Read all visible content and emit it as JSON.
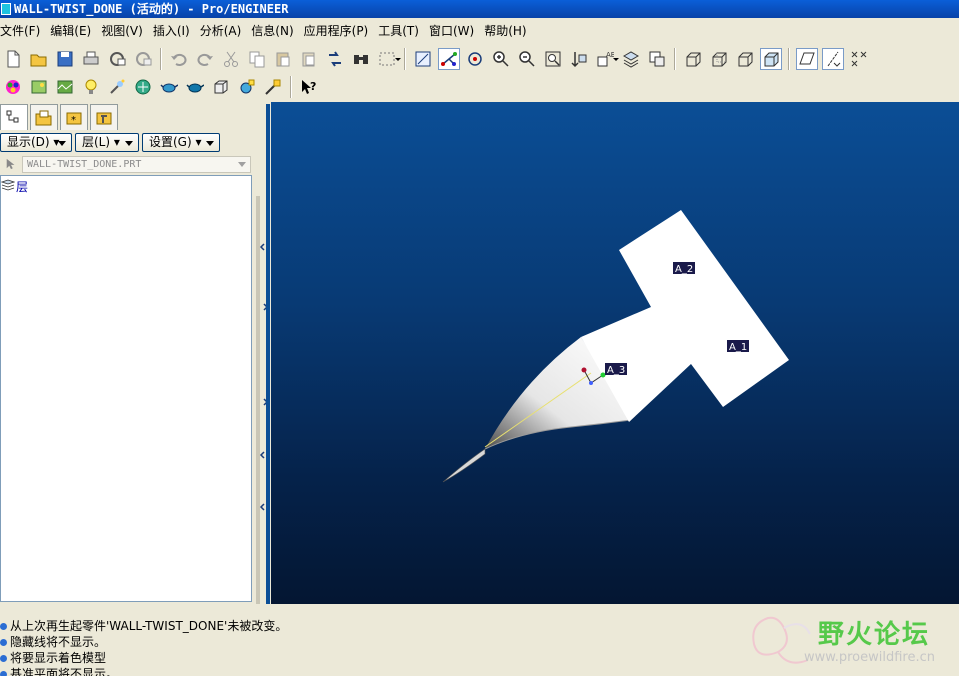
{
  "window": {
    "title": "WALL-TWIST_DONE (活动的) - Pro/ENGINEER"
  },
  "menu": [
    {
      "label": "文件(F)"
    },
    {
      "label": "编辑(E)"
    },
    {
      "label": "视图(V)"
    },
    {
      "label": "插入(I)"
    },
    {
      "label": "分析(A)"
    },
    {
      "label": "信息(N)"
    },
    {
      "label": "应用程序(P)"
    },
    {
      "label": "工具(T)"
    },
    {
      "label": "窗口(W)"
    },
    {
      "label": "帮助(H)"
    }
  ],
  "left_panel": {
    "show_button": "显示(D) ▾",
    "layer_button": "层(L) ▾",
    "settings_button": "设置(G) ▾",
    "model_name": "WALL-TWIST_DONE.PRT",
    "tree_root": "层"
  },
  "graphics": {
    "csys_label": "A_3",
    "datum_labels": [
      {
        "text": "A_2"
      },
      {
        "text": "A_1"
      }
    ],
    "background_top": "#0b4e96",
    "background_bottom": "#041632"
  },
  "messages": [
    "从上次再生起零件'WALL-TWIST_DONE'未被改变。",
    "隐藏线将不显示。",
    "将要显示着色模型",
    "基准平面将不显示。"
  ],
  "watermark": {
    "title": "野火论坛",
    "url": "www.proewildfire.cn"
  },
  "colors": {
    "accent": "#0a5fd8",
    "model": "#ffffff",
    "csys_green": "#22cc33"
  }
}
